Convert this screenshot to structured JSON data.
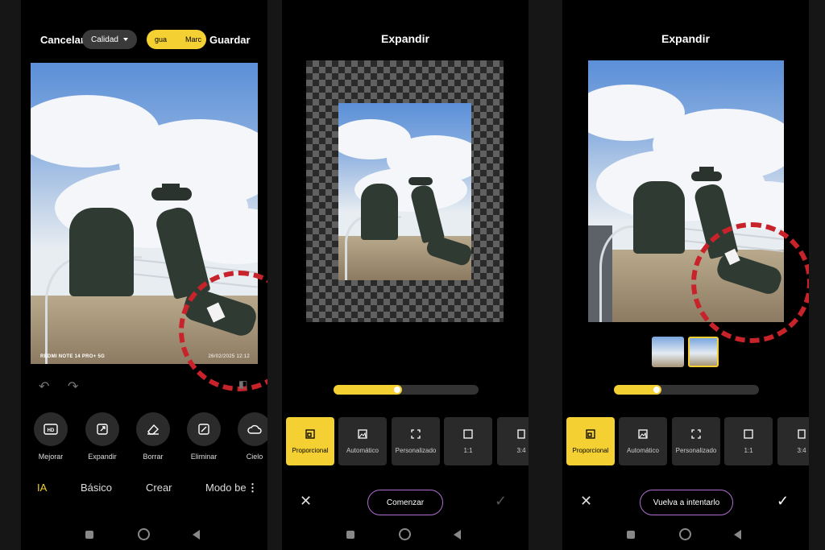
{
  "screen1": {
    "cancel_label": "Cancelar",
    "quality_label": "Calidad",
    "watermark_left": "gua",
    "watermark_right": "Marc",
    "save_label": "Guardar",
    "photo_caption_left": "REDMI NOTE 14 PRO+ 5G",
    "photo_caption_right": "26/02/2025 12:12",
    "tools": [
      {
        "label": "Mejorar",
        "icon": "hd-icon"
      },
      {
        "label": "Expandir",
        "icon": "expand-icon"
      },
      {
        "label": "Borrar",
        "icon": "eraser-icon"
      },
      {
        "label": "Eliminar",
        "icon": "remove-icon"
      },
      {
        "label": "Cielo",
        "icon": "cloud-icon"
      }
    ],
    "tabs": [
      "IA",
      "Básico",
      "Crear",
      "Modo be"
    ]
  },
  "screen2": {
    "title": "Expandir",
    "progress": 0.47,
    "ratios": [
      {
        "label": "Proporcional",
        "active": true
      },
      {
        "label": "Automático",
        "active": false
      },
      {
        "label": "Personalizado",
        "active": false
      },
      {
        "label": "1:1",
        "active": false
      },
      {
        "label": "3:4",
        "active": false
      }
    ],
    "action_label": "Comenzar"
  },
  "screen3": {
    "title": "Expandir",
    "progress": 0.33,
    "ratios": [
      {
        "label": "Proporcional",
        "active": true
      },
      {
        "label": "Automático",
        "active": false
      },
      {
        "label": "Personalizado",
        "active": false
      },
      {
        "label": "1:1",
        "active": false
      },
      {
        "label": "3:4",
        "active": false
      }
    ],
    "action_label": "Vuelva a intentarlo"
  },
  "colors": {
    "accent": "#f5d033",
    "annotation": "#c8222a"
  }
}
